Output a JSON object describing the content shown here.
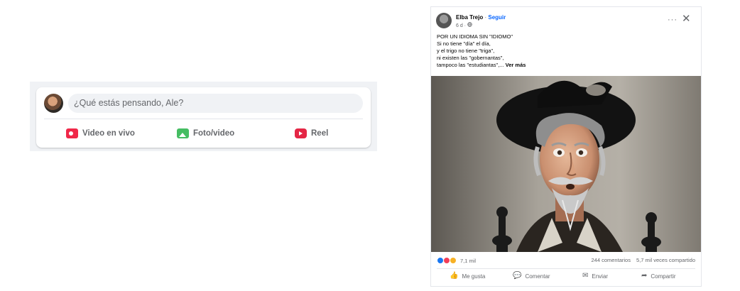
{
  "composer": {
    "prompt": "¿Qué estás pensando, Ale?",
    "actions": [
      {
        "label": "Video en vivo",
        "icon": "live-video-icon",
        "color": "#f02849"
      },
      {
        "label": "Foto/video",
        "icon": "photo-video-icon",
        "color": "#45bd62"
      },
      {
        "label": "Reel",
        "icon": "reel-icon",
        "color": "#e42645"
      }
    ]
  },
  "post": {
    "author": "Elba Trejo",
    "separator": "·",
    "follow_label": "Seguir",
    "time": "6 d ·",
    "privacy_icon": "globe-icon",
    "more_label": "···",
    "close_label": "✕",
    "text_lines": [
      "POR UN IDIOMA SIN \"IDIOMO\"",
      "Si no tiene \"día\" el día,",
      "y el trigo no tiene \"triga\",",
      "ni existen las \"gobernantas\","
    ],
    "last_line": "tampoco las \"estudiantas\",...",
    "see_more": "Ver más",
    "image_description_icon": "quixote-sculpture-image",
    "reactions_count": "7,1 mil",
    "comments": "244 comentarios",
    "shares": "5,7 mil veces compartido",
    "actions": [
      {
        "label": "Me gusta",
        "icon": "thumbs-up-icon",
        "glyph": "👍"
      },
      {
        "label": "Comentar",
        "icon": "comment-icon",
        "glyph": "💬"
      },
      {
        "label": "Enviar",
        "icon": "messenger-icon",
        "glyph": "✉"
      },
      {
        "label": "Compartir",
        "icon": "share-icon",
        "glyph": "➦"
      }
    ]
  },
  "colors": {
    "link": "#0866ff",
    "muted": "#65676b",
    "bg_light": "#f0f2f5"
  }
}
